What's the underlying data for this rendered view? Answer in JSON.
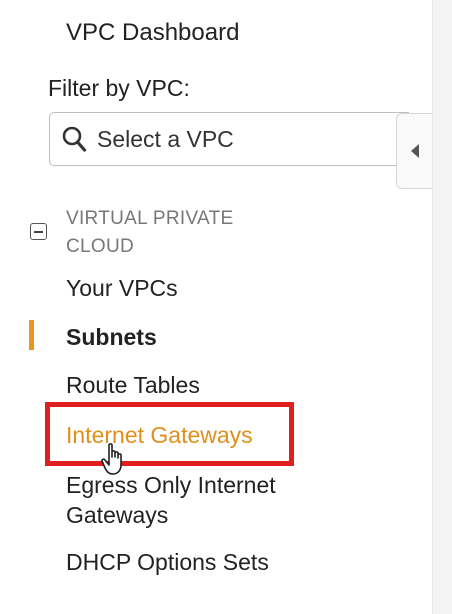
{
  "sidebar": {
    "dashboard_link": "VPC Dashboard",
    "filter_label": "Filter by VPC:",
    "vpc_select": {
      "value": "Select a VPC",
      "icon": "search-icon"
    },
    "collapse_icon": "caret-left-icon",
    "section": {
      "title": "VIRTUAL PRIVATE CLOUD",
      "toggle_icon": "minus-square-icon"
    },
    "items": [
      {
        "label": "Your VPCs",
        "state": "normal"
      },
      {
        "label": "Subnets",
        "state": "active"
      },
      {
        "label": "Route Tables",
        "state": "normal"
      },
      {
        "label": "Internet Gateways",
        "state": "hover"
      },
      {
        "label": "Egress Only Internet Gateways",
        "state": "normal"
      },
      {
        "label": "DHCP Options Sets",
        "state": "normal"
      }
    ]
  },
  "colors": {
    "active_accent": "#e8961c",
    "hover_text": "#e08f1c",
    "highlight_box": "#e0201f",
    "section_title": "#777777"
  },
  "cursor_icon": "hand-pointer-icon"
}
